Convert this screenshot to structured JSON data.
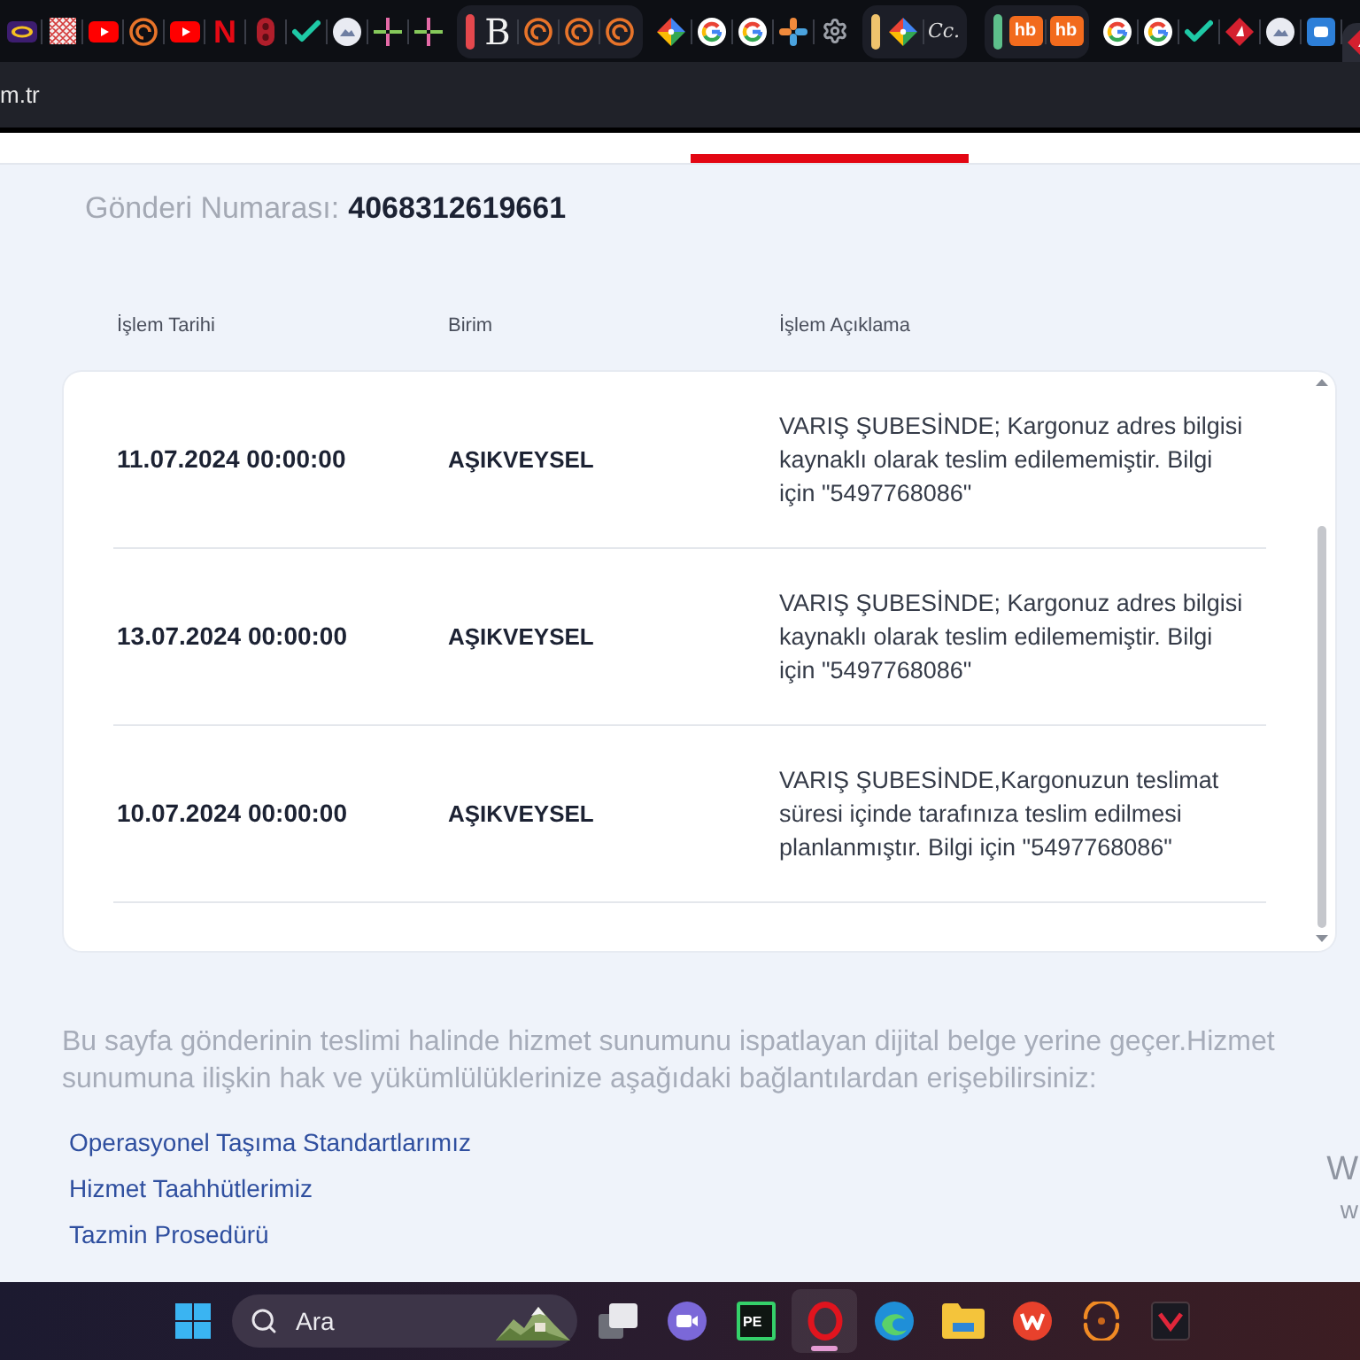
{
  "browser": {
    "tab_strip": [
      {
        "kind": "ring",
        "selected": false
      },
      {
        "kind": "pattern",
        "selected": false
      },
      {
        "kind": "play",
        "selected": false
      },
      {
        "kind": "spiral",
        "selected": false
      },
      {
        "kind": "play",
        "selected": false
      },
      {
        "kind": "monogram",
        "glyph": "N",
        "selected": false
      },
      {
        "kind": "knot",
        "selected": false
      },
      {
        "kind": "check",
        "selected": false
      },
      {
        "kind": "disc",
        "selected": false
      },
      {
        "kind": "pinwheel",
        "selected": false
      },
      {
        "kind": "pinwheel",
        "selected": false
      },
      {
        "kind": "group",
        "color": "#e5484d",
        "tabs": [
          {
            "kind": "serif",
            "glyph": "B",
            "selected": false
          },
          {
            "kind": "spiral",
            "selected": false
          },
          {
            "kind": "spiral",
            "selected": false
          },
          {
            "kind": "spiral",
            "selected": false
          }
        ]
      },
      {
        "kind": "tag",
        "selected": false
      },
      {
        "kind": "google",
        "selected": false
      },
      {
        "kind": "google",
        "selected": false
      },
      {
        "kind": "nodes",
        "selected": false
      },
      {
        "kind": "gear",
        "selected": false
      },
      {
        "kind": "group",
        "color": "#f0c36d",
        "tabs": [
          {
            "kind": "tag",
            "selected": false
          },
          {
            "kind": "script",
            "glyph": "Cc.",
            "selected": false
          }
        ]
      },
      {
        "kind": "group",
        "color": "#5dbf8b",
        "tabs": [
          {
            "kind": "boxed",
            "glyph": "hb",
            "selected": false
          },
          {
            "kind": "boxed",
            "glyph": "hb",
            "selected": false
          }
        ]
      },
      {
        "kind": "google",
        "selected": false
      },
      {
        "kind": "google",
        "selected": false
      },
      {
        "kind": "check",
        "selected": false
      },
      {
        "kind": "diamond",
        "selected": false
      },
      {
        "kind": "disc",
        "selected": false
      },
      {
        "kind": "robot",
        "selected": false
      },
      {
        "kind": "diamond",
        "selected": true
      }
    ],
    "address": "m.tr"
  },
  "shipment": {
    "label": "Gönderi Numarası:",
    "number": "4068312619661"
  },
  "table": {
    "columns": [
      "İşlem Tarihi",
      "Birim",
      "İşlem Açıklama"
    ],
    "rows": [
      {
        "date": "11.07.2024 00:00:00",
        "unit": "AŞIKVEYSEL",
        "description": "VARIŞ ŞUBESİNDE; Kargonuz adres bilgisi kaynaklı olarak teslim edilememiştir. Bilgi için \"5497768086\""
      },
      {
        "date": "13.07.2024 00:00:00",
        "unit": "AŞIKVEYSEL",
        "description": "VARIŞ ŞUBESİNDE; Kargonuz adres bilgisi kaynaklı olarak teslim edilememiştir. Bilgi için \"5497768086\""
      },
      {
        "date": "10.07.2024 00:00:00",
        "unit": "AŞIKVEYSEL",
        "description": "VARIŞ ŞUBESİNDE,Kargonuzun teslimat süresi içinde tarafınıza teslim edilmesi planlanmıştır. Bilgi için \"5497768086\""
      }
    ]
  },
  "notice": "Bu sayfa gönderinin teslimi halinde hizmet sunumunu ispatlayan dijital belge yerine geçer.Hizmet sunumuna ilişkin hak ve yükümlülüklerinize aşağıdaki bağlantılardan erişebilirsiniz:",
  "links": [
    "Operasyonel Taşıma Standartlarımız",
    "Hizmet Taahhütlerimiz",
    "Tazmin Prosedürü"
  ],
  "system_overlay": {
    "line_1": "W",
    "line_2": "w"
  },
  "taskbar": {
    "search": {
      "placeholder": "Ara"
    },
    "apps": [
      {
        "kind": "stack",
        "selected": false
      },
      {
        "kind": "camera",
        "selected": false
      },
      {
        "kind": "monogram",
        "glyph": "PE",
        "selected": false
      },
      {
        "kind": "ring",
        "selected": true
      },
      {
        "kind": "wave",
        "selected": false
      },
      {
        "kind": "folder",
        "selected": false
      },
      {
        "kind": "badge",
        "selected": false
      },
      {
        "kind": "swirl",
        "selected": false
      },
      {
        "kind": "chevron",
        "selected": false
      }
    ]
  }
}
